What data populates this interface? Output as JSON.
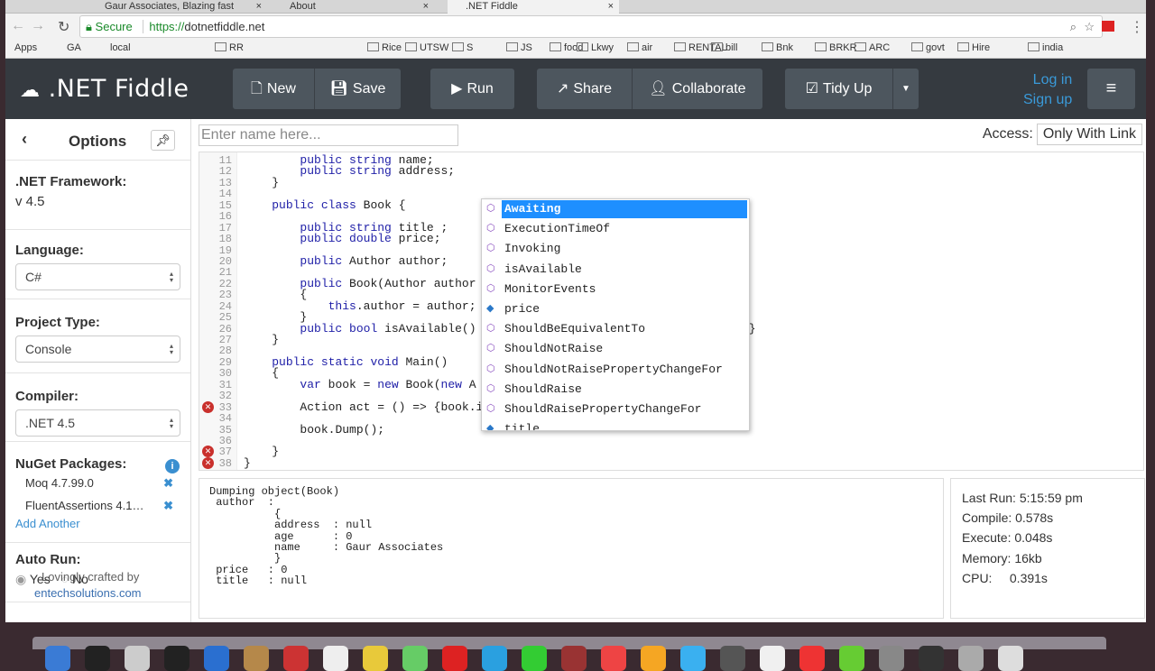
{
  "browser": {
    "tabs": [
      {
        "label": "Gaur Associates, Blazing fast"
      },
      {
        "label": "About"
      },
      {
        "label": ".NET Fiddle"
      }
    ],
    "secure_label": "Secure",
    "url_scheme": "https://",
    "url_host": "dotnetfiddle.net",
    "bookmarks": [
      "Apps",
      "GA",
      "local",
      "RR",
      "Rice",
      "UTSW",
      "S",
      "JS",
      "food",
      "Lkwy",
      "air",
      "RENTAL",
      "bill",
      "Bnk",
      "BRKR",
      "ARC",
      "govt",
      "Hire",
      "india"
    ]
  },
  "toolbar": {
    "logo": ".NET Fiddle",
    "new": "New",
    "save": "Save",
    "run": "Run",
    "share": "Share",
    "collaborate": "Collaborate",
    "tidy": "Tidy Up",
    "login": "Log in",
    "signup": "Sign up"
  },
  "sidebar": {
    "title": "Options",
    "framework_label": ".NET Framework:",
    "framework_value": "v 4.5",
    "language_label": "Language:",
    "language_value": "C#",
    "project_label": "Project Type:",
    "project_value": "Console",
    "compiler_label": "Compiler:",
    "compiler_value": ".NET 4.5",
    "nuget_label": "NuGet Packages:",
    "packages": [
      "Moq 4.7.99.0",
      "FluentAssertions 4.1…"
    ],
    "add_another": "Add Another",
    "autorun_label": "Auto Run:",
    "autorun_yes": "Yes",
    "autorun_no": "No",
    "crafted": "Lovingly crafted by",
    "crafted_link": "entechsolutions.com"
  },
  "editor": {
    "name_placeholder": "Enter name here...",
    "access_label": "Access:",
    "access_value": "Only With Link",
    "lines": [
      {
        "n": "11",
        "code": "        public string name;"
      },
      {
        "n": "12",
        "code": "        public string address;"
      },
      {
        "n": "13",
        "code": "    }"
      },
      {
        "n": "14",
        "code": ""
      },
      {
        "n": "15",
        "code": "    public class Book {"
      },
      {
        "n": "16",
        "code": ""
      },
      {
        "n": "17",
        "code": "        public string title ;"
      },
      {
        "n": "18",
        "code": "        public double price;"
      },
      {
        "n": "19",
        "code": ""
      },
      {
        "n": "20",
        "code": "        public Author author;"
      },
      {
        "n": "21",
        "code": ""
      },
      {
        "n": "22",
        "code": "        public Book(Author author"
      },
      {
        "n": "23",
        "code": "        {"
      },
      {
        "n": "24",
        "code": "            this.author = author;"
      },
      {
        "n": "25",
        "code": "        }"
      },
      {
        "n": "26",
        "code": "        public bool isAvailable()"
      },
      {
        "n": "27",
        "code": "    }"
      },
      {
        "n": "28",
        "code": ""
      },
      {
        "n": "29",
        "code": "    public static void Main()"
      },
      {
        "n": "30",
        "code": "    {"
      },
      {
        "n": "31",
        "code": "        var book = new Book(new A"
      },
      {
        "n": "32",
        "code": ""
      },
      {
        "n": "33",
        "code": "        Action act = () => {book.i"
      },
      {
        "n": "34",
        "code": ""
      },
      {
        "n": "35",
        "code": "        book.Dump();"
      },
      {
        "n": "36",
        "code": ""
      },
      {
        "n": "37",
        "code": "    }"
      },
      {
        "n": "38",
        "code": "}"
      }
    ],
    "line26_tail": ";}",
    "error_lines": [
      "33",
      "37",
      "38"
    ],
    "autocomplete": [
      {
        "label": "Awaiting",
        "icon": "extension-method-icon",
        "selected": true
      },
      {
        "label": "ExecutionTimeOf",
        "icon": "extension-method-icon"
      },
      {
        "label": "Invoking",
        "icon": "extension-method-icon"
      },
      {
        "label": "isAvailable",
        "icon": "method-icon"
      },
      {
        "label": "MonitorEvents",
        "icon": "extension-method-icon"
      },
      {
        "label": "price",
        "icon": "field-icon"
      },
      {
        "label": "ShouldBeEquivalentTo",
        "icon": "extension-method-icon"
      },
      {
        "label": "ShouldNotRaise",
        "icon": "extension-method-icon"
      },
      {
        "label": "ShouldNotRaisePropertyChangeFor",
        "icon": "extension-method-icon"
      },
      {
        "label": "ShouldRaise",
        "icon": "extension-method-icon"
      },
      {
        "label": "ShouldRaisePropertyChangeFor",
        "icon": "extension-method-icon"
      },
      {
        "label": "title",
        "icon": "field-icon"
      }
    ]
  },
  "output": {
    "text": "Dumping object(Book)\n author  :\n          {\n          address  : null\n          age      : 0\n          name     : Gaur Associates\n          }\n price   : 0\n title   : null"
  },
  "stats": {
    "last_run": "Last Run: 5:15:59 pm",
    "compile": "Compile: 0.578s",
    "execute": "Execute: 0.048s",
    "memory": "Memory: 16kb",
    "cpu": "CPU:     0.391s"
  },
  "colors": {
    "toolbar_bg": "#353a40",
    "button_bg": "#4d565e",
    "link": "#3a9ad9",
    "selection": "#1e8fff",
    "error": "#c9302c"
  }
}
